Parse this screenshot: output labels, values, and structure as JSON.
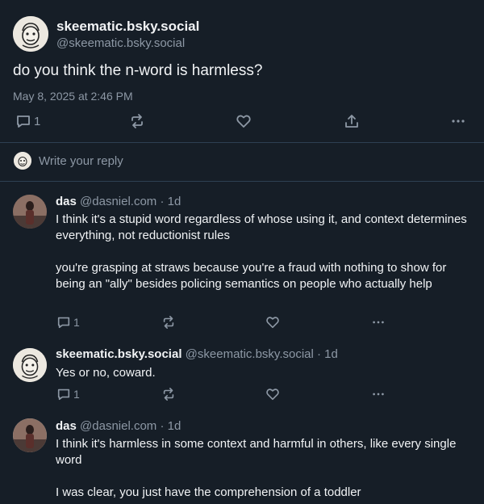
{
  "root": {
    "display_name": "skeematic.bsky.social",
    "handle": "@skeematic.bsky.social",
    "text": "do you think the n-word is harmless?",
    "timestamp": "May 8, 2025 at 2:46 PM",
    "reply_count": "1"
  },
  "reply_box": {
    "placeholder": "Write your reply"
  },
  "replies": [
    {
      "display_name": "das",
      "handle": "@dasniel.com",
      "age": "· 1d",
      "text": "I think it's a stupid word regardless of whose using it, and context determines everything, not reductionist rules\n\nyou're grasping at straws because you're a fraud with nothing to show for being an \"ally\" besides policing semantics on people who actually help",
      "reply_count": "1"
    },
    {
      "display_name": "skeematic.bsky.social",
      "handle": "@skeematic.bsky.social",
      "age": "· 1d",
      "text": "Yes or no, coward.",
      "reply_count": "1"
    },
    {
      "display_name": "das",
      "handle": "@dasniel.com",
      "age": "· 1d",
      "text": "I think it's harmless in some context and harmful in others, like every single word\n\nI was clear, you just have the comprehension of a toddler"
    }
  ],
  "icons": {
    "reply": "speech-bubble-icon",
    "repost": "repost-icon",
    "like": "heart-icon",
    "share": "share-icon",
    "more": "more-dots-icon"
  },
  "colors": {
    "background": "#161e27",
    "text": "#f1f3f5",
    "muted": "#8d98a5",
    "divider": "#2e4052"
  }
}
